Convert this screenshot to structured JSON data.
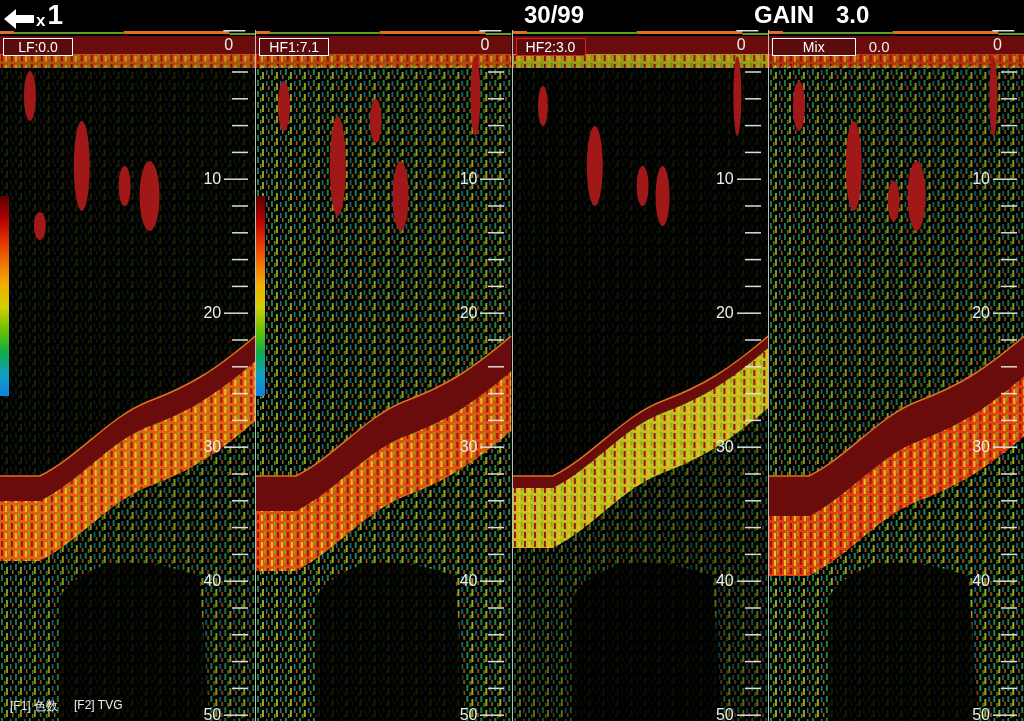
{
  "top_bar": {
    "zoom_prefix": "x",
    "zoom_value": "1",
    "page": "30/99",
    "gain_label": "GAIN",
    "gain_value": "3.0"
  },
  "panels": [
    {
      "label": "LF:0.0",
      "selected": false,
      "top_depth": "0",
      "color_scale": true,
      "depth_labels": [
        "10",
        "20",
        "30",
        "40",
        "50"
      ]
    },
    {
      "label": "HF1:7.1",
      "selected": false,
      "top_depth": "0",
      "color_scale": true,
      "depth_labels": [
        "10",
        "20",
        "30",
        "40",
        "50"
      ]
    },
    {
      "label": "HF2:3.0",
      "selected": true,
      "top_depth": "0",
      "color_scale": false,
      "depth_labels": [
        "10",
        "20",
        "30",
        "40",
        "50"
      ]
    },
    {
      "label": "Mix",
      "selected": false,
      "value": "0.0",
      "top_depth": "0",
      "color_scale": false,
      "depth_labels": [
        "10",
        "20",
        "30",
        "40",
        "50"
      ]
    }
  ],
  "footer": [
    "[F1] 色数",
    "[F2] TVG"
  ]
}
